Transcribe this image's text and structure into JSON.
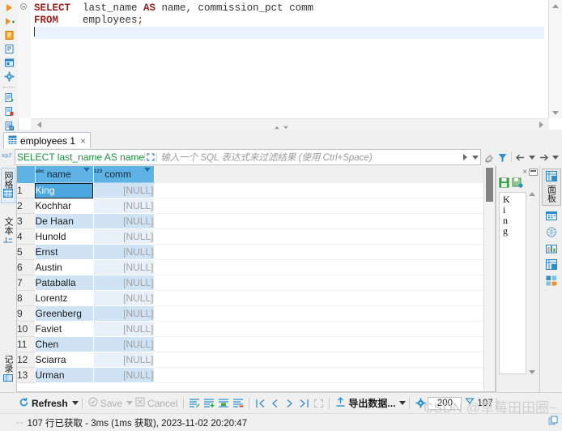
{
  "editor": {
    "lines": [
      {
        "tokens": [
          {
            "t": "SELECT",
            "k": "kw"
          },
          {
            "t": "  last_name ",
            "k": "pl"
          },
          {
            "t": "AS",
            "k": "kw"
          },
          {
            "t": " name, commission_pct comm",
            "k": "pl"
          }
        ]
      },
      {
        "tokens": [
          {
            "t": "FROM",
            "k": "kw"
          },
          {
            "t": "    employees",
            "k": "pl"
          },
          {
            "t": ";",
            "k": "semi"
          }
        ]
      }
    ],
    "line1_plain": "SELECT  last_name AS name, commission_pct comm",
    "line2_plain": "FROM    employees;",
    "gutter_icons": [
      "execute-statement-icon",
      "execute-script-icon",
      "execute-script-new-tab-icon",
      "explain-plan-icon",
      "execute-in-dialog-icon",
      "sql-settings-gear-icon",
      "open-sql-script-icon",
      "save-sql-script-icon",
      "new-sql-editor-icon"
    ]
  },
  "result_tab": {
    "label": "employees 1",
    "close": "×",
    "icon": "table-grid-icon"
  },
  "filter": {
    "type_icon": "sql-text-icon",
    "query_text": "SELECT last_name AS name",
    "expand_icon": "expand-panel-icon",
    "placeholder": "输入一个 SQL 表达式来过滤结果 (使用 Ctrl+Space)",
    "apply_icon": "apply-filter-icon",
    "history_icon": "filter-history-icon",
    "tools": [
      "clear-filter-eraser-icon",
      "filter-funnel-icon",
      "nav-back-icon",
      "nav-back-dropdown-icon",
      "nav-forward-icon",
      "nav-forward-dropdown-icon"
    ]
  },
  "left_tabs": [
    {
      "label": "网格",
      "name": "grid",
      "icon": "grid-icon",
      "active": true
    },
    {
      "label": "文本",
      "name": "text",
      "icon": "text-view-icon",
      "active": false
    },
    {
      "label": "记录",
      "name": "record",
      "icon": "record-view-icon",
      "active": false
    }
  ],
  "grid": {
    "columns": [
      {
        "label": "name",
        "type_icon": "abc",
        "type_color": "#1b3f59"
      },
      {
        "label": "comm",
        "type_icon": "123",
        "type_color": "#1b3f59"
      }
    ],
    "null_text": "[NULL]",
    "rows": [
      {
        "n": "1",
        "name": "King",
        "comm": "[NULL]"
      },
      {
        "n": "2",
        "name": "Kochhar",
        "comm": "[NULL]"
      },
      {
        "n": "3",
        "name": "De Haan",
        "comm": "[NULL]"
      },
      {
        "n": "4",
        "name": "Hunold",
        "comm": "[NULL]"
      },
      {
        "n": "5",
        "name": "Ernst",
        "comm": "[NULL]"
      },
      {
        "n": "6",
        "name": "Austin",
        "comm": "[NULL]"
      },
      {
        "n": "7",
        "name": "Pataballa",
        "comm": "[NULL]"
      },
      {
        "n": "8",
        "name": "Lorentz",
        "comm": "[NULL]"
      },
      {
        "n": "9",
        "name": "Greenberg",
        "comm": "[NULL]"
      },
      {
        "n": "10",
        "name": "Faviet",
        "comm": "[NULL]"
      },
      {
        "n": "11",
        "name": "Chen",
        "comm": "[NULL]"
      },
      {
        "n": "12",
        "name": "Sciarra",
        "comm": "[NULL]"
      },
      {
        "n": "13",
        "name": "Urman",
        "comm": "[NULL]"
      }
    ],
    "selected_row": "1",
    "selected_value": "King"
  },
  "value_panel": {
    "value": "King",
    "chars": [
      "K",
      "i",
      "n",
      "g"
    ],
    "close": "×",
    "tools": [
      "save-value-icon",
      "save-value-as-icon"
    ]
  },
  "right_rail": {
    "panel_tab": {
      "label": "面板",
      "icon": "panel-grid-icon"
    },
    "icons": [
      "calendar-value-icon",
      "spatial-value-icon",
      "chart-value-icon",
      "grid-panel-icon",
      "references-panel-icon"
    ]
  },
  "bottom_toolbar": {
    "refresh": "Refresh",
    "save": "Save",
    "cancel": "Cancel",
    "export": "导出数据...",
    "fetch_size": "200",
    "row_count": "107",
    "icons": [
      "refresh-icon",
      "save-icon",
      "cancel-icon",
      "edit-row-icon",
      "add-row-icon",
      "duplicate-row-icon",
      "delete-row-icon",
      "first-page-icon",
      "prev-page-icon",
      "next-page-icon",
      "last-page-icon",
      "fetch-all-icon",
      "export-icon",
      "grid-settings-gear-icon",
      "row-count-icon"
    ]
  },
  "status": {
    "text": "107 行已获取 - 3ms (1ms 获取), 2023-11-02 20:20:47",
    "dots": "··"
  },
  "watermark": {
    "text": "CSDN @草莓田田圈~"
  },
  "colors": {
    "header_blue": "#5eb3e4",
    "row_blue": "#cfe3f5",
    "selection_blue": "#4ea6e0",
    "sql_green": "#1a8f3c",
    "keyword_red": "#a02020"
  }
}
